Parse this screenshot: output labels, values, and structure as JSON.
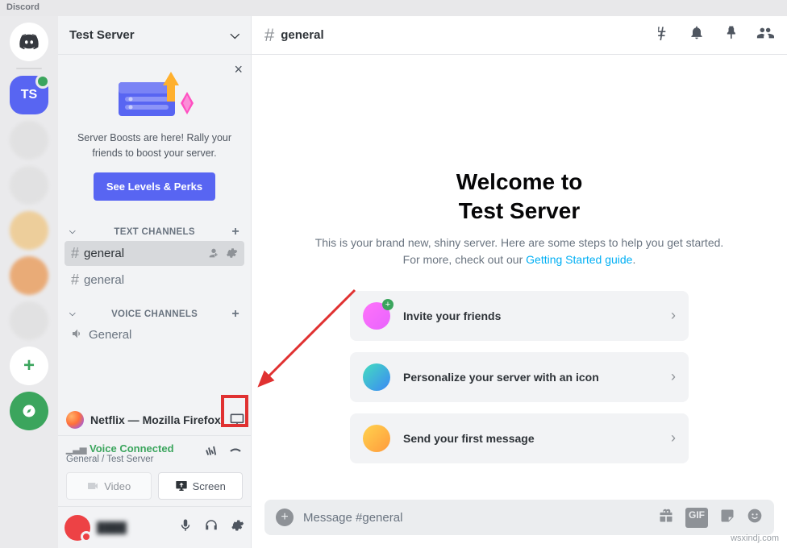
{
  "titlebar": "Discord",
  "server_header": {
    "name": "Test Server",
    "chevron": "⌵"
  },
  "boost": {
    "text": "Server Boosts are here! Rally your friends to boost your server.",
    "button": "See Levels & Perks"
  },
  "text_channels": {
    "header": "TEXT CHANNELS",
    "items": [
      {
        "name": "general",
        "selected": true
      },
      {
        "name": "general",
        "selected": false
      }
    ]
  },
  "voice_channels": {
    "header": "VOICE CHANNELS",
    "items": [
      {
        "name": "General"
      }
    ]
  },
  "firefox_row": {
    "label": "Netflix — Mozilla Firefox"
  },
  "voice_panel": {
    "status": "Voice Connected",
    "sub": "General / Test Server",
    "video_btn": "Video",
    "screen_btn": "Screen"
  },
  "user_area": {
    "name": "████"
  },
  "channel_header": {
    "name": "general"
  },
  "welcome": {
    "title_line1": "Welcome to",
    "title_line2": "Test Server",
    "subtitle_prefix": "This is your brand new, shiny server. Here are some steps to help you get started. For more, check out our ",
    "link_text": "Getting Started guide",
    "subtitle_suffix": "."
  },
  "cards": [
    {
      "label": "Invite your friends",
      "icon": "invite"
    },
    {
      "label": "Personalize your server with an icon",
      "icon": "personalize"
    },
    {
      "label": "Send your first message",
      "icon": "send"
    }
  ],
  "composer": {
    "placeholder": "Message #general",
    "gif_label": "GIF"
  },
  "rail": {
    "selected_initials": "TS"
  },
  "watermark": "wsxindj.com"
}
